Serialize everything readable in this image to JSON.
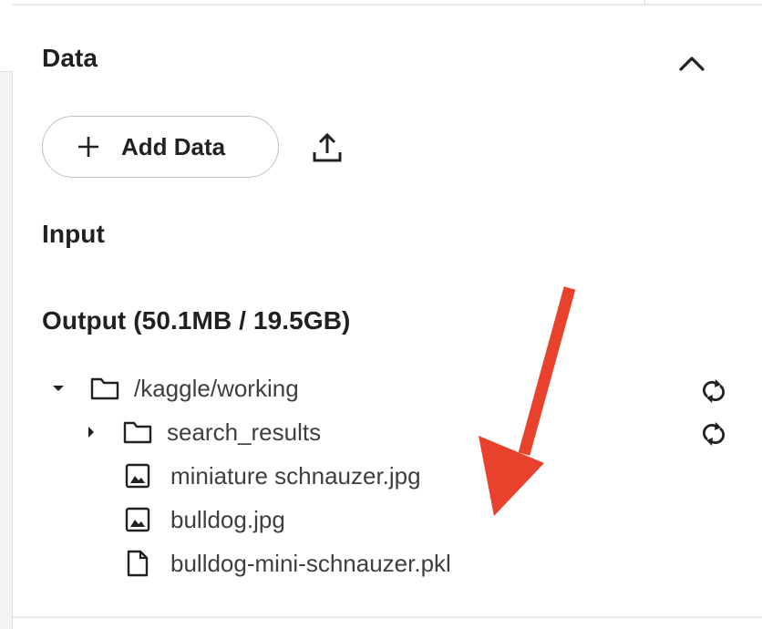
{
  "panel": {
    "title": "Data",
    "add_data_label": "Add Data",
    "input_title": "Input",
    "output_title": "Output (50.1MB / 19.5GB)"
  },
  "tree": {
    "root": {
      "name": "/kaggle/working",
      "type": "folder",
      "expanded": true,
      "icon": "folder-icon"
    },
    "children": [
      {
        "name": "search_results",
        "type": "folder",
        "expanded": false,
        "icon": "folder-icon"
      },
      {
        "name": "miniature schnauzer.jpg",
        "type": "image",
        "icon": "image-file-icon"
      },
      {
        "name": "bulldog.jpg",
        "type": "image",
        "icon": "image-file-icon"
      },
      {
        "name": "bulldog-mini-schnauzer.pkl",
        "type": "file",
        "icon": "file-icon"
      }
    ]
  },
  "icons": {
    "collapse": "chevron-up-icon",
    "add": "plus-icon",
    "upload": "upload-icon",
    "refresh": "refresh-icon",
    "expand": "caret-down-icon",
    "collapsed": "caret-right-icon"
  },
  "colors": {
    "annotation_arrow": "#e8412c",
    "text_primary": "#202124",
    "text_secondary": "#3c4043",
    "border": "#bdc1c6"
  }
}
